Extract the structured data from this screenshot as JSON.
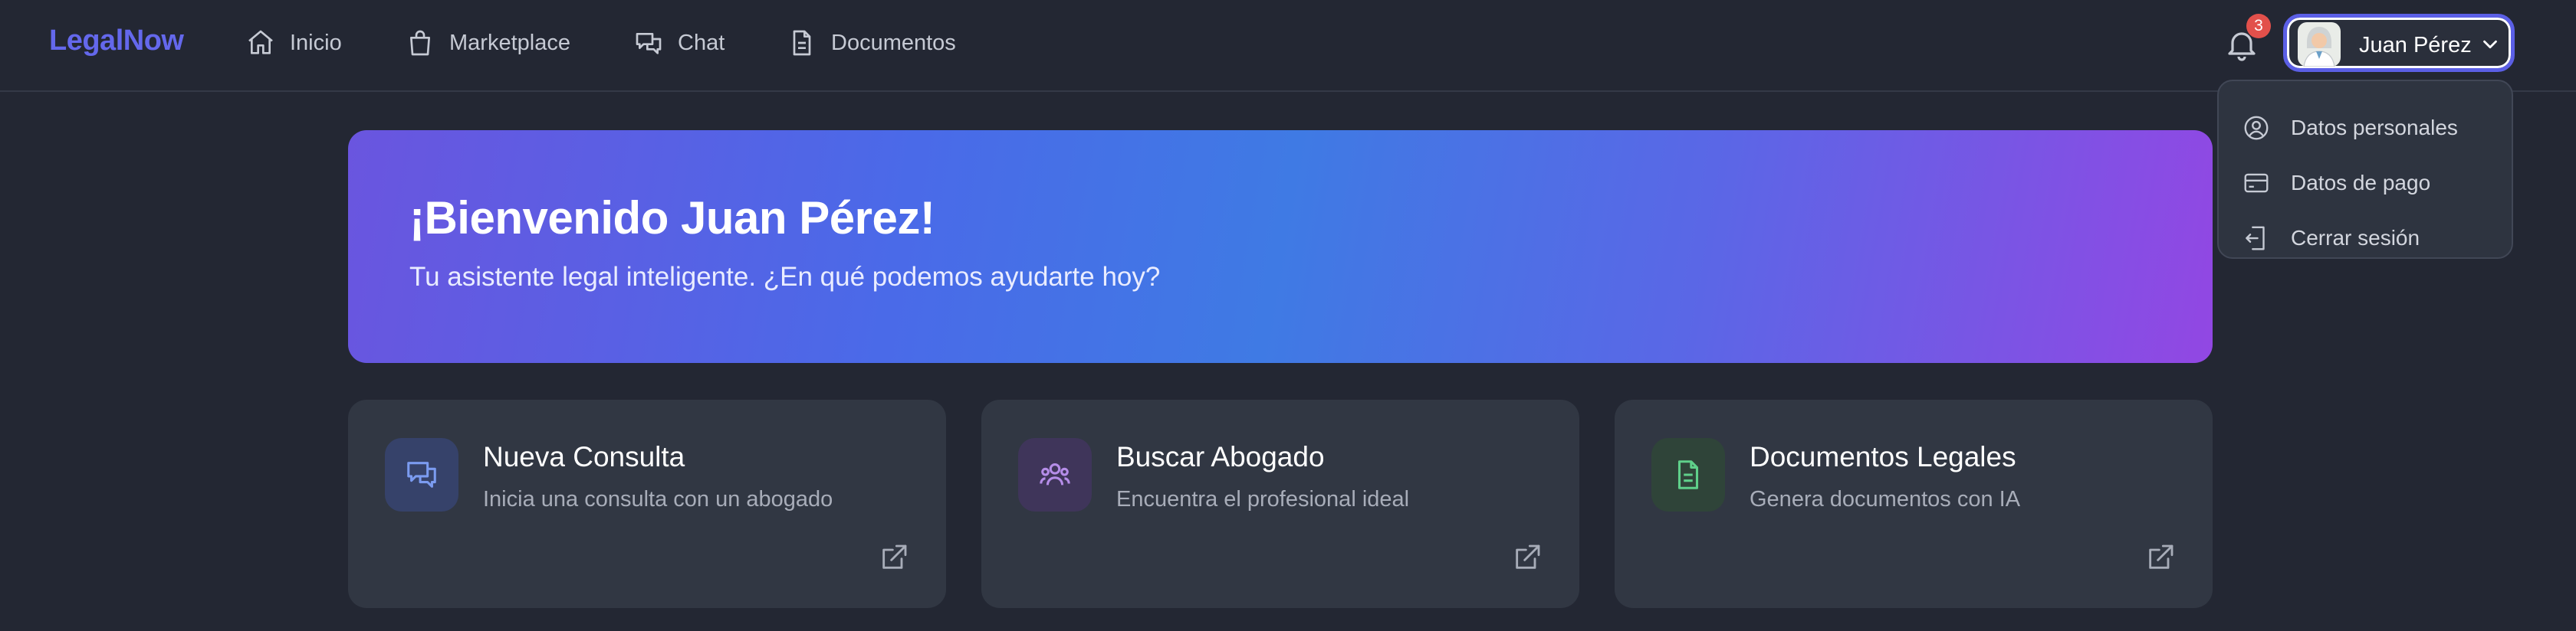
{
  "app": {
    "brand": "LegalNow"
  },
  "nav": {
    "items": [
      {
        "label": "Inicio",
        "icon": "home-icon"
      },
      {
        "label": "Marketplace",
        "icon": "shopping-bag-icon"
      },
      {
        "label": "Chat",
        "icon": "chat-icon"
      },
      {
        "label": "Documentos",
        "icon": "document-icon"
      }
    ]
  },
  "notifications": {
    "count": "3",
    "icon": "bell-icon"
  },
  "user": {
    "name": "Juan Pérez",
    "avatar_icon": "avatar",
    "menu_icon": "chevron-down-icon"
  },
  "user_menu": {
    "items": [
      {
        "label": "Datos personales",
        "icon": "user-circle-icon"
      },
      {
        "label": "Datos de pago",
        "icon": "credit-card-icon"
      },
      {
        "label": "Cerrar sesión",
        "icon": "logout-icon"
      }
    ]
  },
  "hero": {
    "title": "¡Bienvenido Juan Pérez!",
    "subtitle": "Tu asistente legal inteligente. ¿En qué podemos ayudarte hoy?"
  },
  "cards": [
    {
      "title": "Nueva Consulta",
      "subtitle": "Inicia una consulta con un abogado",
      "icon": "chat-bubbles-icon",
      "accent": "#7b9bf0"
    },
    {
      "title": "Buscar Abogado",
      "subtitle": "Encuentra el profesional ideal",
      "icon": "users-icon",
      "accent": "#b58de8"
    },
    {
      "title": "Documentos Legales",
      "subtitle": "Genera documentos con IA",
      "icon": "file-text-icon",
      "accent": "#5fd08a"
    }
  ],
  "colors": {
    "background": "#232733",
    "brand": "#6468ec",
    "card": "#313743",
    "badge": "#e2504b"
  }
}
